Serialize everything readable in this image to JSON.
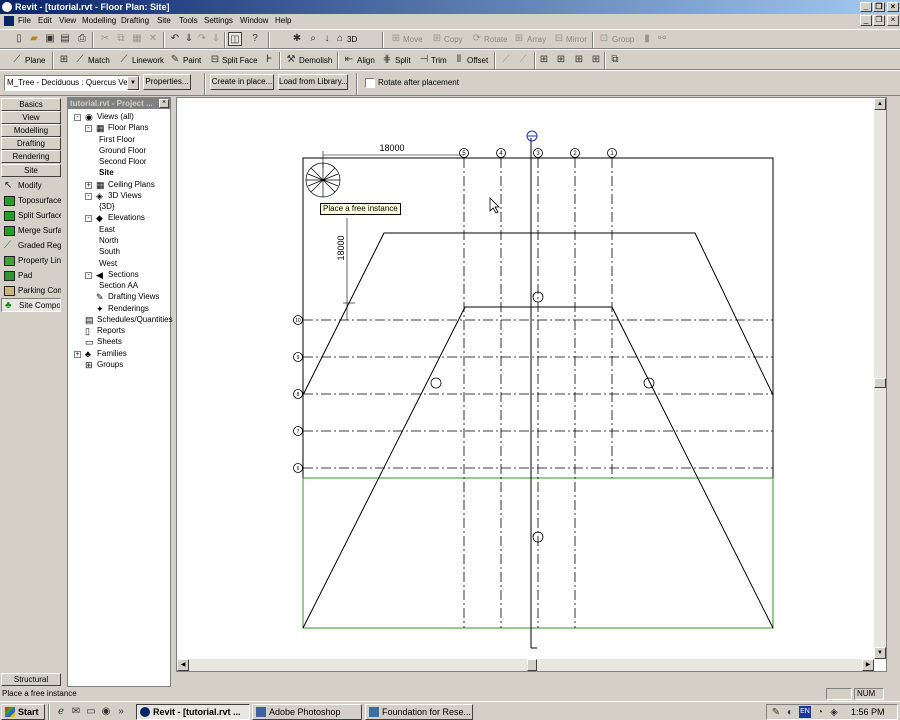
{
  "window": {
    "title": "Revit - [tutorial.rvt - Floor Plan: Site]"
  },
  "menu": [
    "File",
    "Edit",
    "View",
    "Modelling",
    "Drafting",
    "Site",
    "Tools",
    "Settings",
    "Window",
    "Help"
  ],
  "toolbar1": {
    "view_3d_label": "3D",
    "move": "Move",
    "copy": "Copy",
    "rotate": "Rotate",
    "array": "Array",
    "mirror": "Mirror",
    "group": "Group"
  },
  "toolbar2": {
    "plane": "Plane",
    "match": "Match",
    "linework": "Linework",
    "paint": "Paint",
    "split_face": "Split Face",
    "demolish": "Demolish",
    "align": "Align",
    "split": "Split",
    "trim": "Trim",
    "offset": "Offset"
  },
  "options": {
    "type_value": "M_Tree - Deciduous : Quercus Velu",
    "properties": "Properties...",
    "create_in_place": "Create in place...",
    "load_from_library": "Load from Library...",
    "rotate_after_placement": "Rotate after placement",
    "rotate_checked": false
  },
  "design_bar": {
    "tabs": [
      "Basics",
      "View",
      "Modelling",
      "Drafting",
      "Rendering",
      "Site"
    ],
    "tools": [
      "Modify",
      "Toposurface",
      "Split Surface",
      "Merge Surfac",
      "Graded Regio",
      "Property Line",
      "Pad",
      "Parking Comp",
      "Site Compon"
    ],
    "bottom_tab": "Structural"
  },
  "project_browser": {
    "title": "tutorial.rvt - Project ...",
    "items": [
      {
        "text": "Views (all)",
        "level": 0,
        "toggle": "-",
        "icon": "eye-icon"
      },
      {
        "text": "Floor Plans",
        "level": 1,
        "toggle": "-",
        "icon": "floorplan-icon"
      },
      {
        "text": "First Floor",
        "level": 2
      },
      {
        "text": "Ground Floor",
        "level": 2
      },
      {
        "text": "Second Floor",
        "level": 2
      },
      {
        "text": "Site",
        "level": 2,
        "bold": true
      },
      {
        "text": "Ceiling Plans",
        "level": 1,
        "toggle": "+",
        "icon": "floorplan-icon"
      },
      {
        "text": "3D Views",
        "level": 1,
        "toggle": "-",
        "icon": "cube-icon"
      },
      {
        "text": "{3D}",
        "level": 2
      },
      {
        "text": "Elevations",
        "level": 1,
        "toggle": "-",
        "icon": "elevation-icon"
      },
      {
        "text": "East",
        "level": 2
      },
      {
        "text": "North",
        "level": 2
      },
      {
        "text": "South",
        "level": 2
      },
      {
        "text": "West",
        "level": 2
      },
      {
        "text": "Sections",
        "level": 1,
        "toggle": "-",
        "icon": "section-icon"
      },
      {
        "text": "Section AA",
        "level": 2
      },
      {
        "text": "Drafting Views",
        "level": 1,
        "icon": "drafting-icon"
      },
      {
        "text": "Renderings",
        "level": 1,
        "icon": "rendering-icon"
      },
      {
        "text": "Schedules/Quantities",
        "level": 0,
        "icon": "schedule-icon"
      },
      {
        "text": "Reports",
        "level": 0,
        "icon": "report-icon"
      },
      {
        "text": "Sheets",
        "level": 0,
        "icon": "sheet-icon"
      },
      {
        "text": "Families",
        "level": 0,
        "toggle": "+",
        "icon": "families-icon"
      },
      {
        "text": "Groups",
        "level": 0,
        "icon": "groups-icon"
      }
    ]
  },
  "drawing": {
    "tooltip": "Place a free instance",
    "dim_horizontal": "18000",
    "dim_vertical": "18000",
    "grid_top_labels": [
      "5",
      "4",
      "3",
      "2",
      "1"
    ],
    "grid_left_labels": [
      "10",
      "9",
      "8",
      "7",
      "6"
    ]
  },
  "status": {
    "text": "Place a free instance",
    "num": "NUM"
  },
  "taskbar": {
    "start": "Start",
    "tasks": [
      "Revit - [tutorial.rvt ...",
      "Adobe Photoshop",
      "Foundation for Rese..."
    ],
    "lang": "EN",
    "clock": "1:56 PM"
  }
}
